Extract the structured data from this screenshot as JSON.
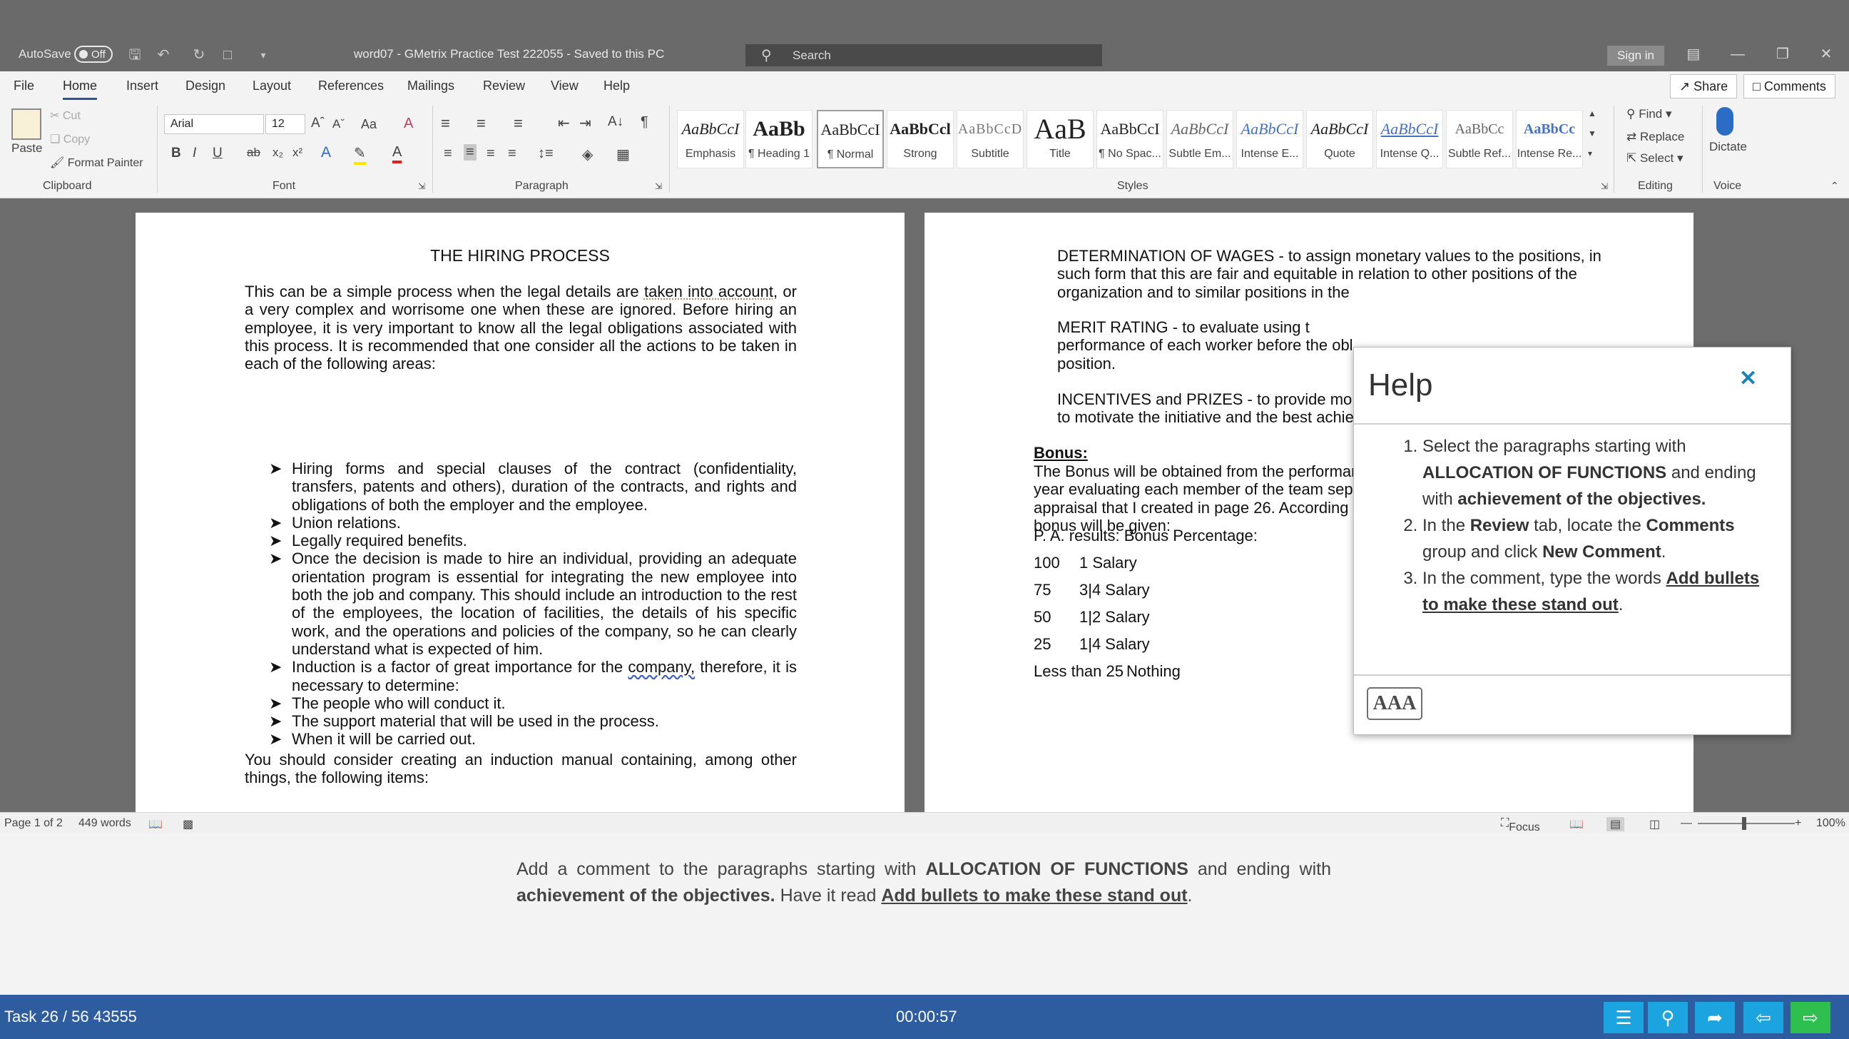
{
  "titlebar": {
    "autosave_label": "AutoSave",
    "autosave_state": "Off",
    "document_title": "word07  -  GMetrix Practice Test 222055  -  Saved to this PC",
    "search_placeholder": "Search",
    "signin_label": "Sign in"
  },
  "tabs": [
    "File",
    "Home",
    "Insert",
    "Design",
    "Layout",
    "References",
    "Mailings",
    "Review",
    "View",
    "Help"
  ],
  "active_tab": "Home",
  "share_label": "Share",
  "comments_label": "Comments",
  "ribbon": {
    "clipboard": {
      "paste": "Paste",
      "cut": "Cut",
      "copy": "Copy",
      "format_painter": "Format Painter",
      "label": "Clipboard"
    },
    "font": {
      "family": "Arial",
      "size": "12",
      "label": "Font"
    },
    "paragraph": {
      "label": "Paragraph"
    },
    "styles": {
      "label": "Styles",
      "items": [
        {
          "preview": "AaBbCcI",
          "name": "Emphasis"
        },
        {
          "preview": "AaBb",
          "name": "¶ Heading 1"
        },
        {
          "preview": "AaBbCcI",
          "name": "¶ Normal"
        },
        {
          "preview": "AaBbCcl",
          "name": "Strong"
        },
        {
          "preview": "AaBbCcD",
          "name": "Subtitle"
        },
        {
          "preview": "AaB",
          "name": "Title"
        },
        {
          "preview": "AaBbCcI",
          "name": "¶ No Spac..."
        },
        {
          "preview": "AaBbCcI",
          "name": "Subtle Em..."
        },
        {
          "preview": "AaBbCcI",
          "name": "Intense E..."
        },
        {
          "preview": "AaBbCcI",
          "name": "Quote"
        },
        {
          "preview": "AaBbCcI",
          "name": "Intense Q..."
        },
        {
          "preview": "AaBbCc",
          "name": "Subtle Ref..."
        },
        {
          "preview": "AaBbCc",
          "name": "Intense Re..."
        }
      ]
    },
    "editing": {
      "find": "Find",
      "replace": "Replace",
      "select": "Select",
      "label": "Editing"
    },
    "voice": {
      "dictate": "Dictate",
      "label": "Voice"
    }
  },
  "page1": {
    "heading": "THE HIRING PROCESS",
    "intro_a": "This can be a simple process when the legal details are ",
    "intro_link": "taken into account",
    "intro_b": ", or a very complex and worrisome one when these are ignored. Before hiring an employee, it is very important to know all the legal obligations associated with this process. It is recommended that one consider all the actions to be taken in each of the following areas:",
    "bullets": [
      "Hiring forms and special clauses of the contract (confidentiality, transfers, patents and others), duration of the contracts, and rights and obligations of both the employer and the employee.",
      "Union relations.",
      "Legally required benefits.",
      "Once the decision is made to hire an individual, providing an adequate orientation program is essential for integrating the new employee into both the job and company. This should include an introduction to the rest of the employees, the location of facilities, the details of his specific work, and the operations and policies of the company, so he can clearly understand what is expected of him."
    ],
    "induction_a": "Induction is a factor of great importance for the ",
    "induction_link": "company,",
    "induction_b": " therefore, it is necessary to determine:",
    "bullets2": [
      "The people who will conduct it.",
      "The support material that will be used in the process.",
      "When it will be carried out."
    ],
    "closing": "You should consider creating an induction manual containing, among other things, the following items:"
  },
  "page2": {
    "wages": "DETERMINATION OF WAGES - to assign monetary values to the positions, in such form that this are fair and equitable in relation to other positions of the organization and to similar positions in the",
    "merit": "MERIT RATING - to evaluate using t",
    "merit2": "performance of each worker before the obl",
    "merit3": "position.",
    "incentives": "INCENTIVES and PRIZES - to provide mo",
    "incentives2": "to motivate the initiative and the best achie",
    "bonus_heading": "Bonus:",
    "bonus_text1": "The Bonus will be obtained from the performar",
    "bonus_text2": "year evaluating each member of the team sepa",
    "bonus_text3": "appraisal that I created in page 26. According",
    "bonus_text4": "bonus will be given:",
    "results_header": "P. A. results: Bonus Percentage:",
    "rows": [
      {
        "score": "100",
        "bonus": "1 Salary"
      },
      {
        "score": "75",
        "bonus": "3|4 Salary"
      },
      {
        "score": "50",
        "bonus": "1|2 Salary"
      },
      {
        "score": "25",
        "bonus": "1|4 Salary"
      },
      {
        "score": "Less than 25",
        "bonus": "Nothing"
      }
    ]
  },
  "help": {
    "title": "Help",
    "step1_a": "Select the paragraphs starting with ",
    "step1_b": "ALLOCATION OF FUNCTIONS",
    "step1_c": " and ending with ",
    "step1_d": "achievement of the objectives.",
    "step2_a": "In the ",
    "step2_b": "Review",
    "step2_c": " tab, locate the ",
    "step2_d": "Comments",
    "step2_e": " group and click ",
    "step2_f": "New Comment",
    "step2_g": ".",
    "step3_a": "In the comment, type the words ",
    "step3_b": "Add bullets to make these stand out",
    "step3_c": ".",
    "text_size_button": "AAA"
  },
  "statusbar": {
    "page": "Page 1 of 2",
    "words": "449 words",
    "focus": "Focus",
    "zoom": "100%"
  },
  "task": {
    "text_a": "Add a comment to the paragraphs starting with ",
    "text_b": "ALLOCATION OF FUNCTIONS",
    "text_c": " and ending with ",
    "text_d": "achievement of the objectives.",
    "text_e": " Have it read ",
    "text_f": "Add bullets to make these stand out",
    "text_g": ".",
    "task_number": "Task 26 / 56 43555",
    "timer": "00:00:57"
  }
}
